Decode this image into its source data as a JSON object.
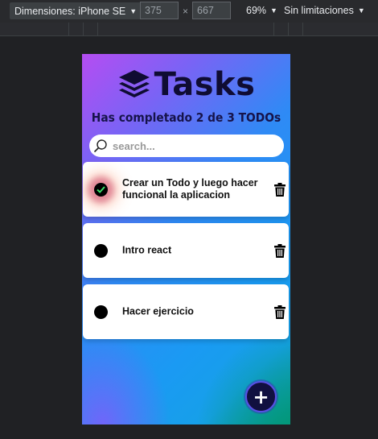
{
  "devtools": {
    "device_label": "Dimensiones: iPhone SE",
    "width": "375",
    "height": "667",
    "dim_separator": "×",
    "zoom": "69%",
    "throttling": "Sin limitaciones"
  },
  "app": {
    "title": "Tasks",
    "counter": "Has completado 2 de 3 TODOs",
    "search_placeholder": "search...",
    "add_label": "+",
    "todos": [
      {
        "text": "Crear un Todo y luego hacer funcional la aplicacion",
        "completed": true
      },
      {
        "text": "Intro react",
        "completed": false
      },
      {
        "text": "Hacer ejercicio",
        "completed": false
      }
    ]
  },
  "colors": {
    "title": "#0f0c33",
    "check_mark": "#3be06a",
    "fab_bg": "#111040"
  }
}
